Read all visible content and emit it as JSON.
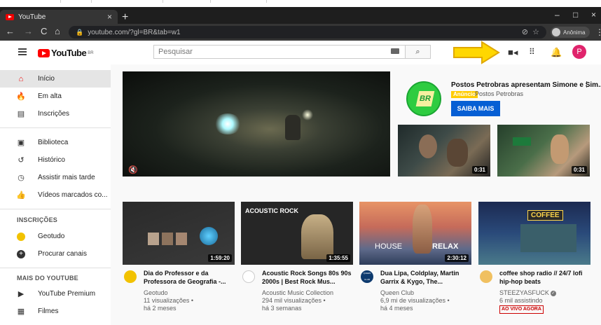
{
  "browser": {
    "tab_title": "YouTube",
    "tab_close": "×",
    "new_tab": "+",
    "url": "youtube.com/?gl=BR&tab=w1",
    "profile_label": "Anônima",
    "win_min": "–",
    "win_max": "□",
    "win_close": "×"
  },
  "header": {
    "logo_text": "YouTube",
    "logo_country": "BR",
    "search_placeholder": "Pesquisar",
    "avatar_letter": "P",
    "arrow_color": "#ffd700"
  },
  "sidebar": {
    "main": [
      {
        "label": "Início",
        "icon": "home-icon",
        "active": true
      },
      {
        "label": "Em alta",
        "icon": "fire-icon",
        "active": false
      },
      {
        "label": "Inscrições",
        "icon": "subscriptions-icon",
        "active": false
      }
    ],
    "library": [
      {
        "label": "Biblioteca",
        "icon": "library-icon"
      },
      {
        "label": "Histórico",
        "icon": "history-icon"
      },
      {
        "label": "Assistir mais tarde",
        "icon": "clock-icon"
      },
      {
        "label": "Vídeos marcados co...",
        "icon": "thumbs-up-icon"
      }
    ],
    "subs_heading": "INSCRIÇÕES",
    "subs": [
      {
        "label": "Geotudo",
        "icon": "channel-avatar-icon"
      },
      {
        "label": "Procurar canais",
        "icon": "add-circle-icon"
      }
    ],
    "more_heading": "MAIS DO YOUTUBE",
    "more": [
      {
        "label": "YouTube Premium",
        "icon": "youtube-premium-icon"
      },
      {
        "label": "Filmes",
        "icon": "film-icon"
      }
    ]
  },
  "ad": {
    "title": "Postos Petrobras apresentam Simone e Sim...",
    "badge": "Anúncio",
    "channel": "Postos Petrobras",
    "cta": "SAIBA MAIS",
    "logo_text": "BR",
    "thumbs": [
      {
        "duration": "0:31"
      },
      {
        "duration": "0:31"
      }
    ]
  },
  "videos": [
    {
      "title": "Dia do Professor e da Professora de Geografia -...",
      "channel": "Geotudo",
      "views": "11 visualizações •",
      "age": "há 2 meses",
      "duration": "1:59:20",
      "live": "",
      "avatar_color": "#f2c200"
    },
    {
      "title": "Acoustic Rock Songs 80s 90s 2000s | Best Rock Mus...",
      "channel": "Acoustic Music Collection",
      "views": "294 mil visualizações •",
      "age": "há 3 semanas",
      "duration": "1:35:55",
      "thumb_text": "ACOUSTIC ROCK",
      "live": "",
      "avatar_color": "#ffffff"
    },
    {
      "title": "Dua Lipa, Coldplay, Martin Garrix & Kygo, The...",
      "channel": "Queen Club",
      "views": "6,9 mi de visualizações •",
      "age": "há 4 meses",
      "duration": "2:30:12",
      "thumb_left": "HOUSE",
      "thumb_right": "RELAX",
      "live": "",
      "avatar_color": "#0d3a6e",
      "avatar_text": "QUEEN CLUB"
    },
    {
      "title": "coffee shop radio // 24/7 lofi hip-hop beats",
      "channel": "STEEZYASFUCK",
      "views": "6 mil assistindo",
      "age": "",
      "duration": "",
      "thumb_text": "COFFEE",
      "live": "AO VIVO AGORA",
      "avatar_color": "#f0c060"
    }
  ]
}
